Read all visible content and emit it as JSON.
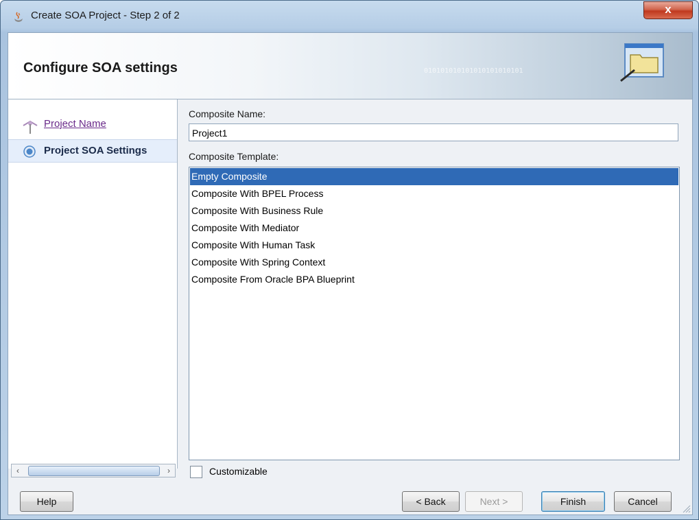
{
  "window": {
    "title": "Create SOA Project - Step 2 of 2",
    "close_label": "x"
  },
  "banner": {
    "title": "Configure SOA settings",
    "binary_text": "010101010101010101010101"
  },
  "nav": {
    "items": [
      {
        "label": "Project Name"
      },
      {
        "label": "Project SOA Settings"
      }
    ]
  },
  "form": {
    "composite_name_label": "Composite Name:",
    "composite_name_value": "Project1",
    "composite_template_label": "Composite Template:",
    "templates": [
      "Empty Composite",
      "Composite With BPEL Process",
      "Composite With Business Rule",
      "Composite With Mediator",
      "Composite With Human Task",
      "Composite With Spring Context",
      "Composite From Oracle BPA Blueprint"
    ],
    "selected_template": "Empty Composite",
    "customizable_label": "Customizable",
    "customizable_checked": false
  },
  "buttons": {
    "help": "Help",
    "back": "< Back",
    "next": "Next >",
    "finish": "Finish",
    "cancel": "Cancel"
  },
  "colors": {
    "selection": "#2f6ab6",
    "visited_link": "#6a2a8a"
  }
}
